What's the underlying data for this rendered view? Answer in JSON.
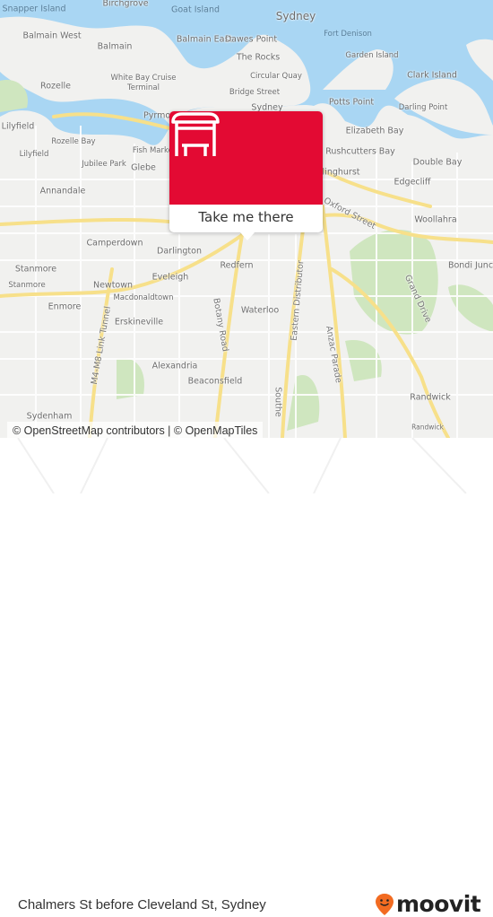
{
  "map": {
    "labels": [
      "Snapper Island",
      "Birchgrove",
      "Goat Island",
      "Sydney",
      "Balmain West",
      "Balmain East",
      "Dawes Point",
      "Fort Denison",
      "Balmain",
      "Garden Island",
      "The Rocks",
      "Rozelle",
      "White Bay Cruise",
      "Terminal",
      "Circular Quay",
      "Clark Island",
      "Bridge Street",
      "Potts Point",
      "Darling Point",
      "Lilyfield",
      "Rozelle Bay",
      "Fish Market",
      "Elizabeth Bay",
      "Rushcutters Bay",
      "Lilyfield",
      "Jubilee Park",
      "Glebe",
      "Double Bay",
      "Edgecliff",
      "Annandale",
      "Oxford Street",
      "Woollahra",
      "Camperdown",
      "Darlington",
      "Redfern",
      "Bondi Junc",
      "Stanmore",
      "Eveleigh",
      "Newtown",
      "Stanmore",
      "Macdonaldtown",
      "Enmore",
      "Waterloo",
      "Erskineville",
      "Botany Road",
      "Eastern Distributor",
      "Anzac Parade",
      "Grand Drive",
      "M4-M8 Link Tunnel",
      "Alexandria",
      "Beaconsfield",
      "Randwick",
      "Randwick",
      "Sydenham",
      "Southe",
      "Pyrmont",
      "Sydney",
      "Darlinghurst"
    ],
    "colors": {
      "water": "#a9d6f3",
      "land": "#f1f1ef",
      "park": "#cfe6bf",
      "major_road": "#f7e08a",
      "minor_road": "#ffffff"
    }
  },
  "popup": {
    "icon": "bus-stop-shelter-icon",
    "button_label": "Take me there",
    "color": "#e30a33"
  },
  "attribution": "© OpenStreetMap contributors | © OpenMapTiles",
  "footer": {
    "stop_name": "Chalmers St before Cleveland St, Sydney",
    "logo_text": "moovit",
    "logo_color": "#f26b21"
  }
}
